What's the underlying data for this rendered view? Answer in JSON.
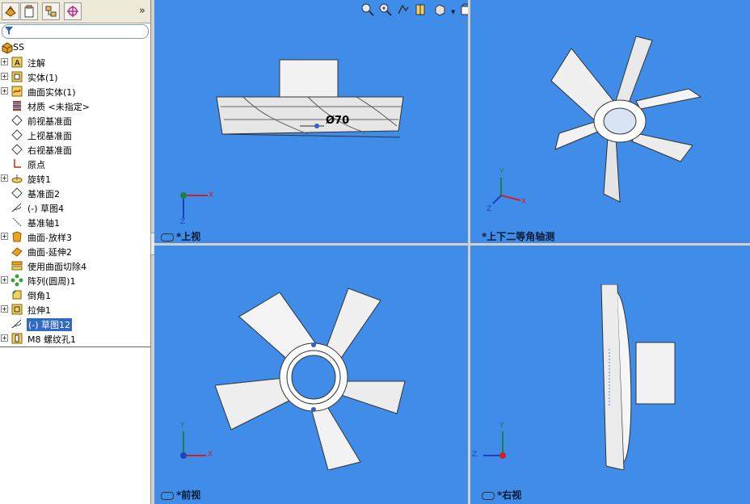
{
  "feature_tree": {
    "root_label": "SS",
    "items": [
      {
        "label": "注解",
        "expandable": true,
        "icon": "annotation-icon"
      },
      {
        "label": "实体(1)",
        "expandable": true,
        "icon": "solid-body-icon"
      },
      {
        "label": "曲面实体(1)",
        "expandable": true,
        "icon": "surface-body-icon"
      },
      {
        "label": "材质 <未指定>",
        "expandable": false,
        "icon": "material-icon"
      },
      {
        "label": "前视基准面",
        "expandable": false,
        "icon": "plane-icon"
      },
      {
        "label": "上视基准面",
        "expandable": false,
        "icon": "plane-icon"
      },
      {
        "label": "右视基准面",
        "expandable": false,
        "icon": "plane-icon"
      },
      {
        "label": "原点",
        "expandable": false,
        "icon": "origin-icon"
      },
      {
        "label": "旋转1",
        "expandable": true,
        "icon": "revolve-icon"
      },
      {
        "label": "基准面2",
        "expandable": false,
        "icon": "plane-icon"
      },
      {
        "label": "(-) 草图4",
        "expandable": false,
        "icon": "sketch-icon"
      },
      {
        "label": "基准轴1",
        "expandable": false,
        "icon": "axis-icon"
      },
      {
        "label": "曲面-放样3",
        "expandable": true,
        "icon": "surface-loft-icon"
      },
      {
        "label": "曲面-延伸2",
        "expandable": false,
        "icon": "surface-extend-icon"
      },
      {
        "label": "使用曲面切除4",
        "expandable": false,
        "icon": "surface-cut-icon"
      },
      {
        "label": "阵列(圆周)1",
        "expandable": true,
        "icon": "circular-pattern-icon"
      },
      {
        "label": "倒角1",
        "expandable": false,
        "icon": "chamfer-icon"
      },
      {
        "label": "拉伸1",
        "expandable": true,
        "icon": "extrude-icon"
      },
      {
        "label": "(-) 草图12",
        "expandable": false,
        "icon": "sketch-icon",
        "selected": true
      },
      {
        "label": "M8 螺纹孔1",
        "expandable": true,
        "icon": "hole-icon"
      }
    ]
  },
  "tabs_more": "»",
  "viewports": {
    "top_left": {
      "label": "*上视",
      "dimension": "Ø70"
    },
    "top_right": {
      "label": "*上下二等角轴测"
    },
    "bottom_left": {
      "label": "*前视"
    },
    "bottom_right": {
      "label": "*右视"
    }
  },
  "axes": {
    "x": "X",
    "y": "Y",
    "z": "Z"
  },
  "colors": {
    "viewport_bg": "#3f8ce9",
    "selection": "#316ac5",
    "panel_bg": "#ffffff"
  },
  "toolbar_icons": [
    "zoom-to-fit-icon",
    "zoom-area-icon",
    "previous-view-icon",
    "section-view-icon",
    "view-orientation-icon",
    "display-style-icon",
    "hide-show-icon",
    "scene-icon",
    "view-settings-icon"
  ]
}
